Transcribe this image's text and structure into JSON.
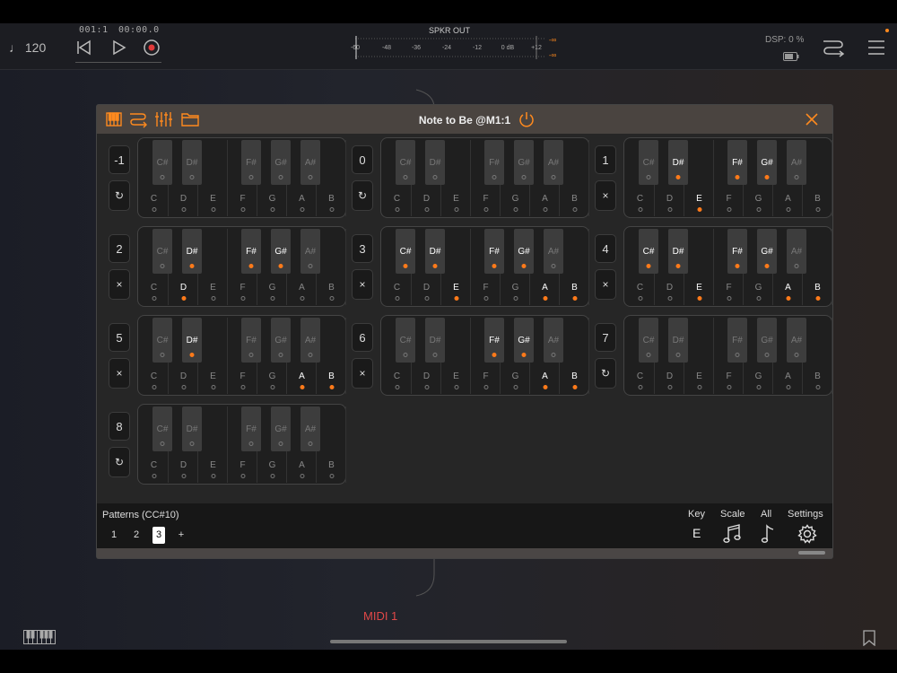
{
  "transport": {
    "tempo": "♩ 120",
    "bar": "001:1",
    "time": "00:00.0"
  },
  "meter": {
    "label": "SPKR OUT",
    "ticks": [
      "-60",
      "-48",
      "-36",
      "-24",
      "-12",
      "0 dB",
      "+12"
    ],
    "peak_top": "-∞",
    "peak_bottom": "-∞"
  },
  "dsp": "DSP:  0 %",
  "plugin": {
    "title": "Note to Be @M1:1"
  },
  "icons": {
    "tempo": "note-icon",
    "rewind": "rewind-icon",
    "play": "play-icon",
    "record": "record-icon",
    "routing": "routing-icon",
    "menu": "menu-icon",
    "battery": "battery-icon",
    "keyboard": "piano-icon",
    "bookmark": "bookmark-icon",
    "power": "power-icon",
    "close": "close-icon",
    "settings": "gear-icon"
  },
  "colors": {
    "accent": "#ff7a1a",
    "midi": "#e04848"
  },
  "keyboard_labels": {
    "black": [
      "C#",
      "D#",
      "F#",
      "G#",
      "A#"
    ],
    "white": [
      "C",
      "D",
      "E",
      "F",
      "G",
      "A",
      "B"
    ]
  },
  "patterns_cells": [
    {
      "num": "-1",
      "action": "↻",
      "black_on": [
        false,
        false,
        false,
        false,
        false
      ],
      "white_on": [
        false,
        false,
        false,
        false,
        false,
        false,
        false
      ]
    },
    {
      "num": "0",
      "action": "↻",
      "black_on": [
        false,
        false,
        false,
        false,
        false
      ],
      "white_on": [
        false,
        false,
        false,
        false,
        false,
        false,
        false
      ]
    },
    {
      "num": "1",
      "action": "×",
      "black_on": [
        false,
        true,
        true,
        true,
        false
      ],
      "white_on": [
        false,
        false,
        true,
        false,
        false,
        false,
        false
      ]
    },
    {
      "num": "2",
      "action": "×",
      "black_on": [
        false,
        true,
        true,
        true,
        false
      ],
      "white_on": [
        false,
        true,
        false,
        false,
        false,
        false,
        false
      ]
    },
    {
      "num": "3",
      "action": "×",
      "black_on": [
        true,
        true,
        true,
        true,
        false
      ],
      "white_on": [
        false,
        false,
        true,
        false,
        false,
        true,
        true
      ]
    },
    {
      "num": "4",
      "action": "×",
      "black_on": [
        true,
        true,
        true,
        true,
        false
      ],
      "white_on": [
        false,
        false,
        true,
        false,
        false,
        true,
        true
      ]
    },
    {
      "num": "5",
      "action": "×",
      "black_on": [
        false,
        true,
        false,
        false,
        false
      ],
      "white_on": [
        false,
        false,
        false,
        false,
        false,
        true,
        true
      ]
    },
    {
      "num": "6",
      "action": "×",
      "black_on": [
        false,
        false,
        true,
        true,
        false
      ],
      "white_on": [
        false,
        false,
        false,
        false,
        false,
        true,
        true
      ]
    },
    {
      "num": "7",
      "action": "↻",
      "black_on": [
        false,
        false,
        false,
        false,
        false
      ],
      "white_on": [
        false,
        false,
        false,
        false,
        false,
        false,
        false
      ]
    },
    {
      "num": "8",
      "action": "↻",
      "black_on": [
        false,
        false,
        false,
        false,
        false
      ],
      "white_on": [
        false,
        false,
        false,
        false,
        false,
        false,
        false
      ]
    }
  ],
  "footer": {
    "patterns_label": "Patterns (CC#10)",
    "patterns": [
      "1",
      "2",
      "3",
      "+"
    ],
    "selected_pattern": "3",
    "key_label": "Key",
    "key_value": "E",
    "scale_label": "Scale",
    "all_label": "All",
    "settings_label": "Settings"
  },
  "midi_label": "MIDI 1"
}
